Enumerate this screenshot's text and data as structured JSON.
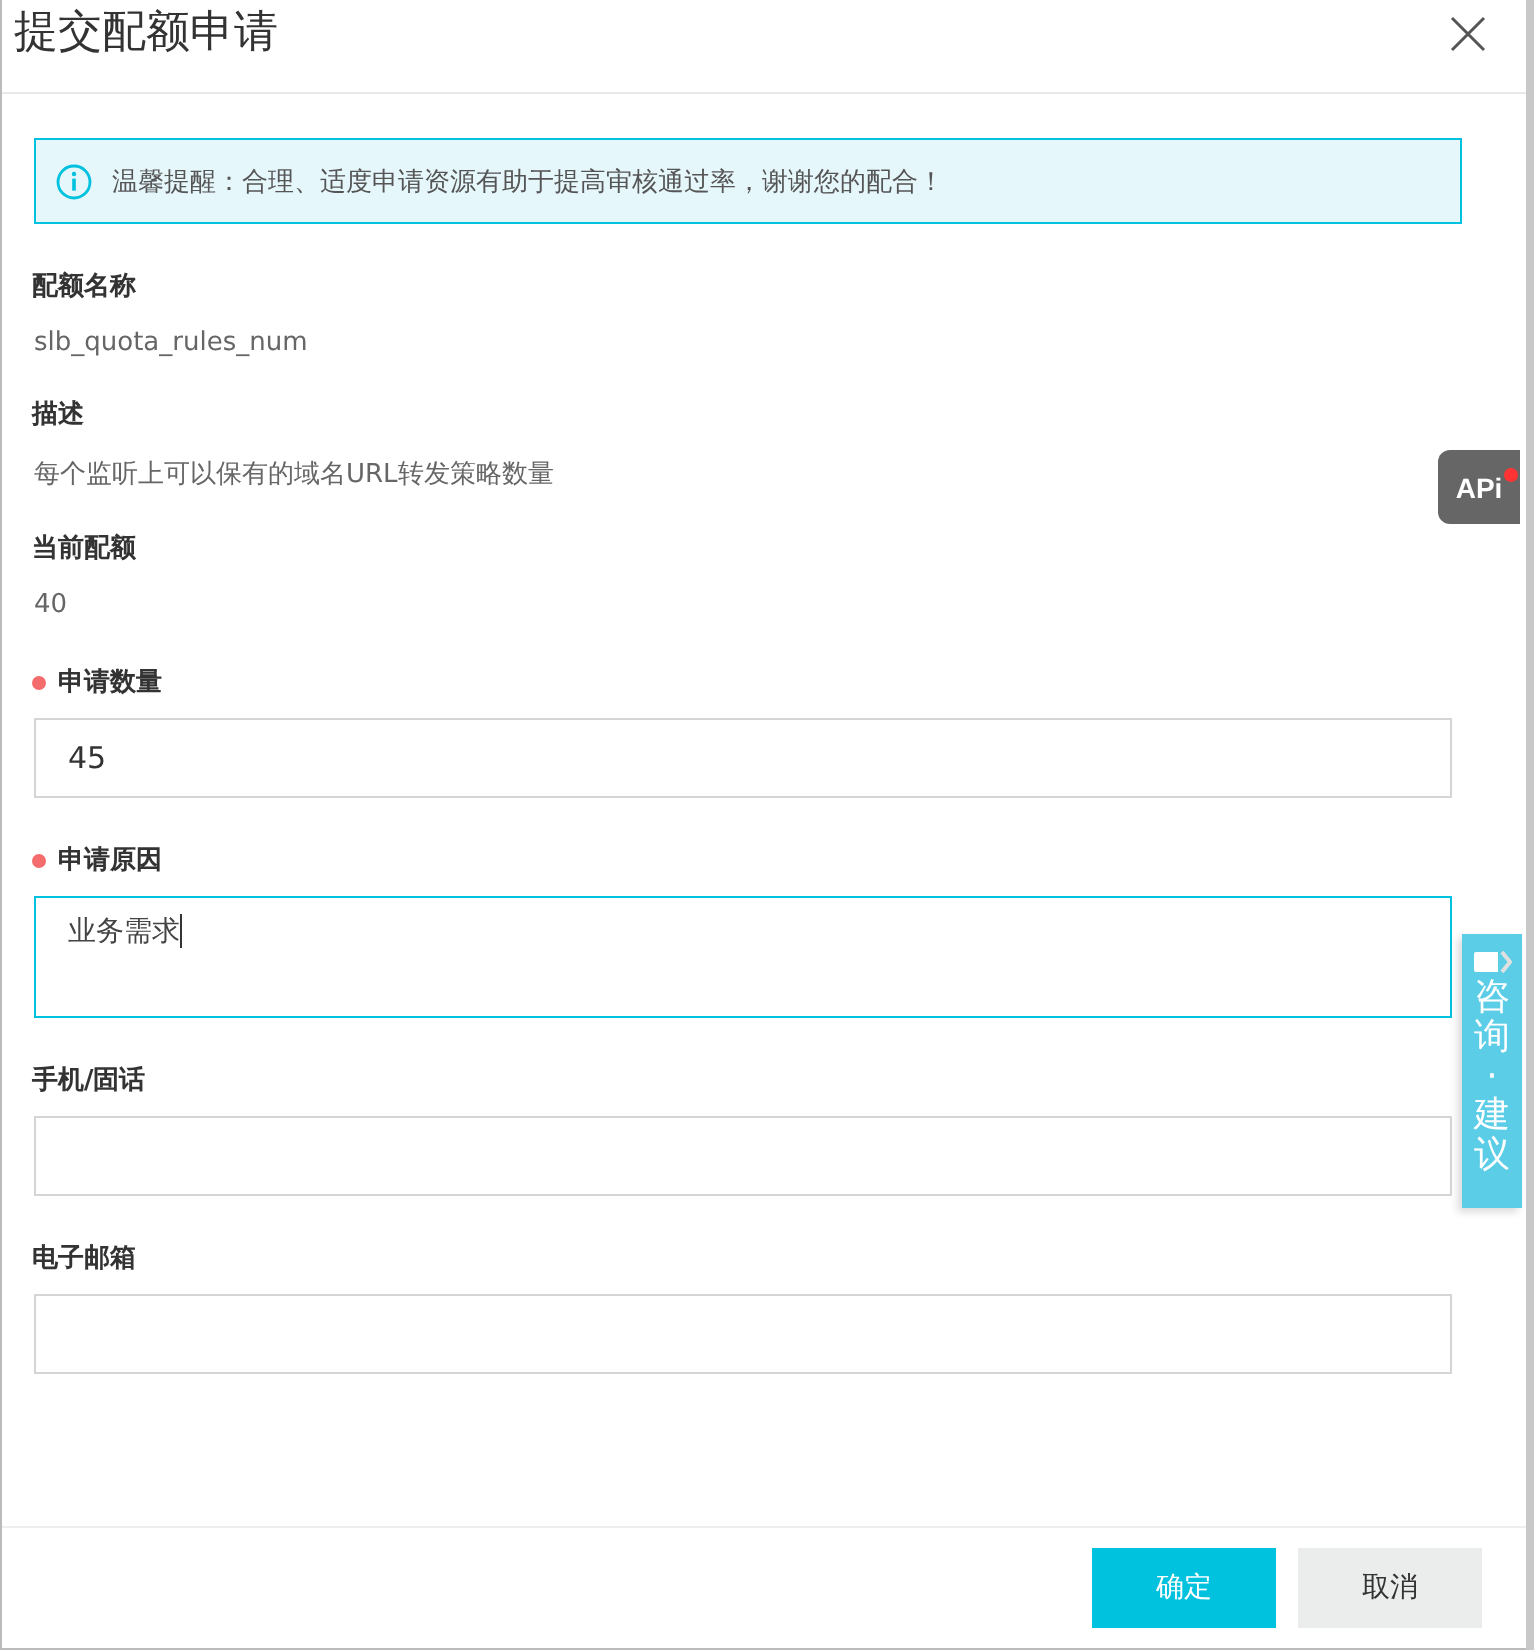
{
  "dialog": {
    "title": "提交配额申请"
  },
  "notice": {
    "text": "温馨提醒：合理、适度申请资源有助于提高审核通过率，谢谢您的配合！"
  },
  "fields": [
    {
      "kind": "readonly",
      "label": "配额名称",
      "value": "slb_quota_rules_num"
    },
    {
      "kind": "readonly",
      "label": "描述",
      "value": "每个监听上可以保有的域名URL转发策略数量"
    },
    {
      "kind": "readonly",
      "label": "当前配额",
      "value": "40"
    },
    {
      "kind": "input",
      "label": "申请数量",
      "required": true,
      "focused": false,
      "value": "45"
    },
    {
      "kind": "textarea",
      "label": "申请原因",
      "required": true,
      "focused": true,
      "value": "业务需求"
    },
    {
      "kind": "input",
      "label": "手机/固话",
      "required": false,
      "focused": false
    },
    {
      "kind": "input",
      "label": "电子邮箱",
      "required": false,
      "focused": false
    }
  ],
  "buttons": [
    {
      "label": "确定",
      "primary": true
    },
    {
      "label": "取消",
      "primary": false
    }
  ],
  "api_badge": {
    "label": "APi",
    "notification": true
  },
  "consult_tab": {
    "label": "咨询·建议"
  }
}
